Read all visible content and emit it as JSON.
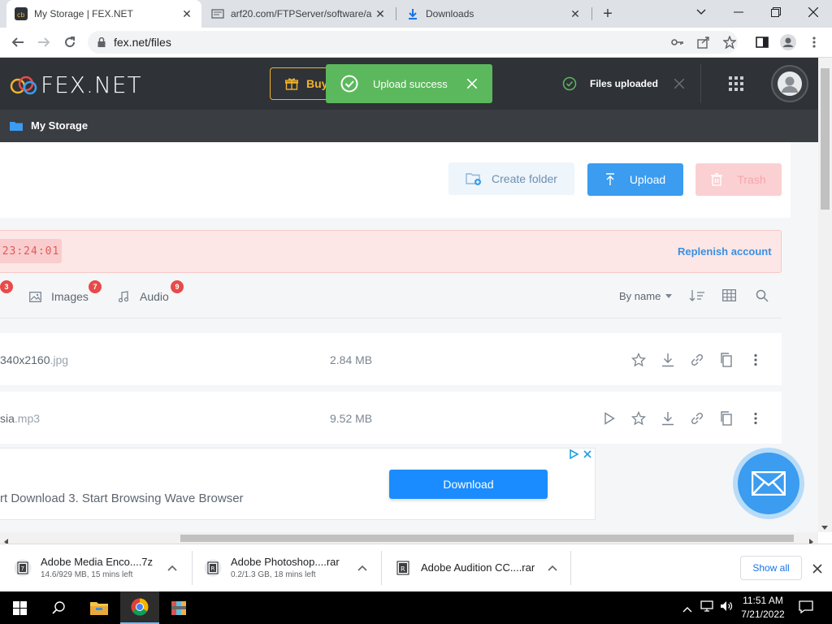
{
  "browser": {
    "tabs": [
      {
        "title": "My Storage | FEX.NET",
        "active": true
      },
      {
        "title": "arf20.com/FTPServer/software/a",
        "active": false
      },
      {
        "title": "Downloads",
        "active": false
      }
    ],
    "address": "fex.net/files",
    "new_tab_symbol": "+"
  },
  "header": {
    "logo_text": "FEX.NET",
    "buy_label": "Buy",
    "toast_message": "Upload success",
    "files_uploaded_label": "Files uploaded"
  },
  "breadcrumb": {
    "label": "My Storage"
  },
  "actions": {
    "create_folder": "Create folder",
    "upload": "Upload",
    "trash": "Trash"
  },
  "warning": {
    "timer": "23:24:01",
    "replenish": "Replenish account"
  },
  "filters": {
    "items": [
      {
        "label": "",
        "count": "3"
      },
      {
        "label": "Images",
        "count": "7"
      },
      {
        "label": "Audio",
        "count": "9"
      }
    ],
    "sort_label": "By name"
  },
  "files": [
    {
      "name_visible": "340x2160",
      "ext": ".jpg",
      "size": "2.84 MB"
    },
    {
      "name_visible": "sia",
      "ext": ".mp3",
      "size": "9.52 MB"
    }
  ],
  "ad": {
    "text": "rt Download 3. Start Browsing Wave Browser",
    "button": "Download"
  },
  "downloads": [
    {
      "name": "Adobe Media Enco....7z",
      "status": "14.6/929 MB, 15 mins left"
    },
    {
      "name": "Adobe Photoshop....rar",
      "status": "0.2/1.3 GB, 18 mins left"
    },
    {
      "name": "Adobe Audition CC....rar",
      "status": ""
    }
  ],
  "show_all": "Show all",
  "taskbar": {
    "time": "11:51 AM",
    "date": "7/21/2022"
  },
  "colors": {
    "upload_blue": "#3b9cf0",
    "toast_green": "#5cb85c",
    "header_dark": "#2f3237",
    "badge_red": "#e84a4a"
  }
}
